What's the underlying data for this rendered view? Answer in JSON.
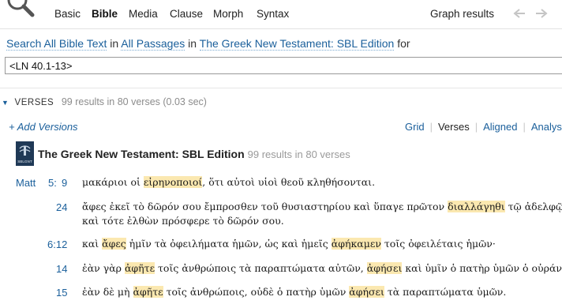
{
  "toolbar": {
    "tabs": [
      "Basic",
      "Bible",
      "Media",
      "Clause",
      "Morph",
      "Syntax"
    ],
    "active_tab": "Bible",
    "graph_results": "Graph results"
  },
  "search": {
    "scope_type": "Search All Bible Text",
    "in1": "in",
    "scope_passages": "All Passages",
    "in2": "in",
    "scope_version": "The Greek New Testament: SBL Edition",
    "for": "for",
    "query": "<LN 40.1-13>"
  },
  "results": {
    "label": "VERSES",
    "summary": "99 results in 80 verses (0.03 sec)",
    "add_versions": "+ Add Versions",
    "view_tabs": [
      "Grid",
      "Verses",
      "Aligned",
      "Analysis"
    ],
    "active_view": "Verses",
    "book": {
      "icon_text": "SBLGNT",
      "title": "The Greek New Testament: SBL Edition",
      "summary": "99 results in 80 verses"
    },
    "verses": [
      {
        "book": "Matt",
        "chapter": "5:",
        "verse": "9",
        "lines": [
          [
            "μακάριοι οἱ ",
            {
              "hl": "εἰρηνοποιοί"
            },
            ", ὅτι αὐτοὶ υἱοὶ θεοῦ κληθήσονται."
          ]
        ]
      },
      {
        "book": "",
        "chapter": "",
        "verse": "24",
        "lines": [
          [
            "ἄφες ἐκεῖ τὸ δῶρόν σου ἔμπροσθεν τοῦ θυσιαστηρίου καὶ ὕπαγε πρῶτον ",
            {
              "hl": "διαλλάγηθι"
            },
            " τῷ ἀδελφῷ σου,"
          ],
          [
            "καὶ τότε ἐλθὼν πρόσφερε τὸ δῶρόν σου."
          ]
        ]
      },
      {
        "book": "",
        "chapter": "",
        "verse": "6:12",
        "lines": [
          [
            "καὶ ",
            {
              "hl": "ἄφες"
            },
            " ἡμῖν τὰ ὀφειλήματα ἡμῶν, ὡς καὶ ἡμεῖς ",
            {
              "hl": "ἀφήκαμεν"
            },
            " τοῖς ὀφειλέταις ἡμῶν·"
          ]
        ]
      },
      {
        "book": "",
        "chapter": "",
        "verse": "14",
        "lines": [
          [
            "ἐὰν γὰρ ",
            {
              "hl": "ἀφῆτε"
            },
            " τοῖς ἀνθρώποις τὰ παραπτώματα αὐτῶν, ",
            {
              "hl": "ἀφήσει"
            },
            " καὶ ὑμῖν ὁ πατὴρ ὑμῶν ὁ οὐράνιος·"
          ]
        ]
      },
      {
        "book": "",
        "chapter": "",
        "verse": "15",
        "lines": [
          [
            "ἐὰν δὲ μὴ ",
            {
              "hl": "ἀφῆτε"
            },
            " τοῖς ἀνθρώποις, οὐδὲ ὁ πατὴρ ὑμῶν ",
            {
              "hl": "ἀφήσει"
            },
            " τὰ παραπτώματα ὑμῶν."
          ]
        ]
      }
    ]
  },
  "icons": {
    "search": "magnifier-icon",
    "collapse": "triangle-down-icon",
    "back": "arrow-left-icon",
    "forward": "arrow-right-icon"
  },
  "colors": {
    "link": "#1a5f9b",
    "highlight": "#fbe8b0",
    "book_icon": "#1f3956"
  }
}
